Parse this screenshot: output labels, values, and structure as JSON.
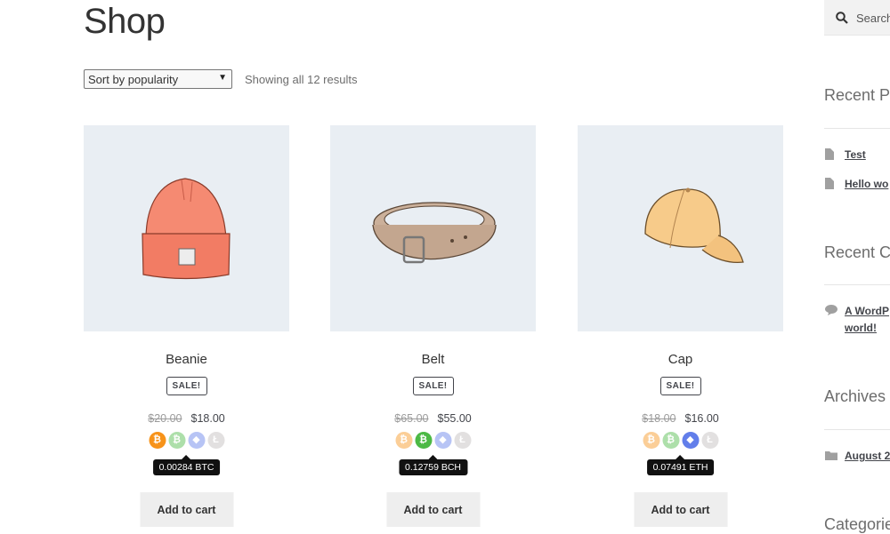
{
  "page": {
    "title": "Shop"
  },
  "toolbar": {
    "sort_selected": "Sort by popularity",
    "result_count": "Showing all 12 results"
  },
  "products": [
    {
      "name": "Beanie",
      "badge": "SALE!",
      "old_price": "$20.00",
      "price": "$18.00",
      "crypto_tooltip": "0.00284 BTC",
      "active_coin": "btc",
      "button": "Add to cart"
    },
    {
      "name": "Belt",
      "badge": "SALE!",
      "old_price": "$65.00",
      "price": "$55.00",
      "crypto_tooltip": "0.12759 BCH",
      "active_coin": "bch",
      "button": "Add to cart"
    },
    {
      "name": "Cap",
      "badge": "SALE!",
      "old_price": "$18.00",
      "price": "$16.00",
      "crypto_tooltip": "0.07491 ETH",
      "active_coin": "eth",
      "button": "Add to cart"
    }
  ],
  "coin_icons": [
    "bitcoin-icon",
    "bitcoin-cash-icon",
    "ethereum-icon",
    "litecoin-icon"
  ],
  "colors": {
    "btc": "#f7931a",
    "bch": "#4cb945",
    "eth": "#627eea",
    "ltc": "#bfbbbb",
    "thumb_bg": "#e9eef3"
  },
  "sidebar": {
    "search_placeholder": "Search",
    "recent_posts_title": "Recent Po",
    "recent_posts": [
      "Test",
      "Hello wo"
    ],
    "recent_comments_title": "Recent Co",
    "recent_comment_line1": "A WordP",
    "recent_comment_line2": "world!",
    "archives_title": "Archives",
    "archive_item": "August 2",
    "categories_title": "Categorie"
  }
}
